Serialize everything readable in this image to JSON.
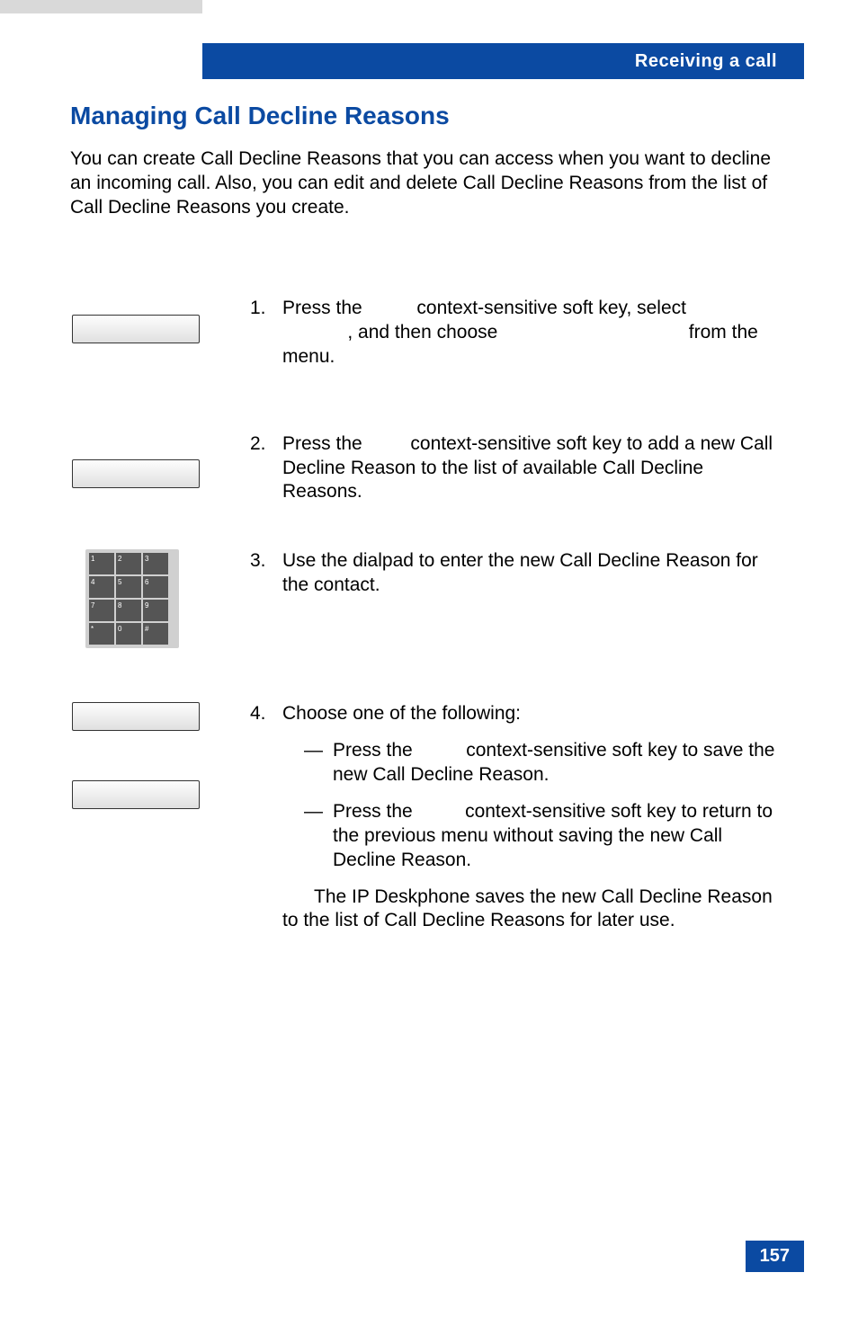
{
  "header": {
    "chapter": "Receiving a call"
  },
  "section": {
    "title": "Managing Call Decline Reasons",
    "intro": "You can create Call Decline Reasons that you can access when you want to decline an incoming call. Also, you can edit and delete Call Decline Reasons from the list of Call Decline Reasons you create."
  },
  "steps": {
    "s1": {
      "num": "1.",
      "text1": "Press the ",
      "text2": " context-sensitive soft key, select ",
      "text3": ", and then choose ",
      "text4": " from the menu."
    },
    "s2": {
      "num": "2.",
      "text1": "Press the ",
      "text2": " context-sensitive soft key to add a new Call Decline Reason to the list of available Call Decline Reasons."
    },
    "s3": {
      "num": "3.",
      "text": "Use the dialpad to enter the new Call Decline Reason for the contact."
    },
    "s4": {
      "num": "4.",
      "lead": "Choose one of the following:",
      "opt1a": "Press the ",
      "opt1b": " context-sensitive soft key to save the new Call Decline Reason.",
      "opt2a": "Press the ",
      "opt2b": " context-sensitive soft key to return to the previous menu without saving the new Call Decline Reason.",
      "note": "The IP Deskphone saves the new Call Decline Reason to the list of Call Decline Reasons for later use."
    }
  },
  "dialpad": [
    "1",
    "2",
    "3",
    "4",
    "5",
    "6",
    "7",
    "8",
    "9",
    "*",
    "0",
    "#"
  ],
  "dashes": {
    "d": "—"
  },
  "page_number": "157"
}
